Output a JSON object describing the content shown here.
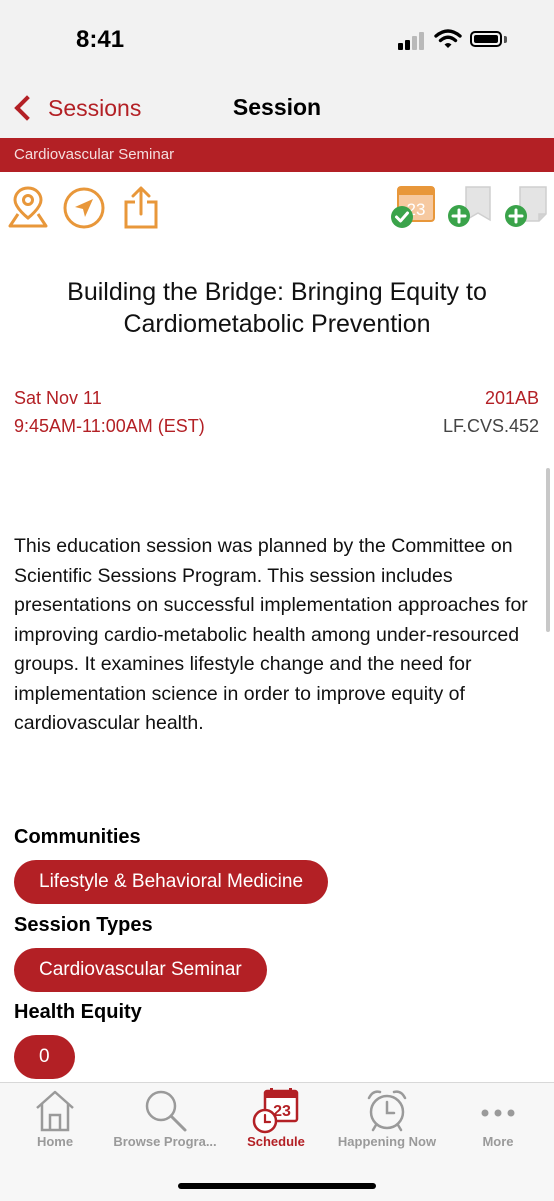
{
  "status_bar": {
    "time": "8:41"
  },
  "nav": {
    "back_label": "Sessions",
    "title": "Session"
  },
  "category": "Cardiovascular Seminar",
  "actions": {
    "left": [
      "location-pin-icon",
      "navigate-arrow-icon",
      "share-icon"
    ],
    "right": [
      "calendar-added-icon",
      "add-bookmark-icon",
      "add-note-icon"
    ],
    "calendar_day": "23"
  },
  "session": {
    "title": "Building the Bridge: Bringing Equity to Cardiometabolic Prevention",
    "date": "Sat Nov 11",
    "time": "9:45AM-11:00AM (EST)",
    "room": "201AB",
    "code": "LF.CVS.452",
    "description": "This education session was planned by the Committee on Scientific Sessions Program. This session includes presentations on successful implementation approaches for improving cardio-metabolic health among under-resourced groups. It examines lifestyle change and the need for implementation science in order to improve equity of cardiovascular health."
  },
  "sections": [
    {
      "heading": "Communities",
      "tag": "Lifestyle & Behavioral Medicine"
    },
    {
      "heading": "Session Types",
      "tag": "Cardiovascular Seminar"
    },
    {
      "heading": "Health Equity",
      "tag": "0"
    }
  ],
  "tabs": [
    {
      "label": "Home",
      "icon": "home-icon",
      "active": false
    },
    {
      "label": "Browse Progra...",
      "icon": "search-icon",
      "active": false
    },
    {
      "label": "Schedule",
      "icon": "calendar-clock-icon",
      "active": true,
      "calendar_day": "23"
    },
    {
      "label": "Happening Now",
      "icon": "alarm-clock-icon",
      "active": false
    },
    {
      "label": "More",
      "icon": "more-dots-icon",
      "active": false
    }
  ],
  "colors": {
    "accent": "#b32025",
    "action_orange": "#e8973a",
    "check_green": "#3aa34a",
    "tab_inactive": "#9a9a9a"
  }
}
